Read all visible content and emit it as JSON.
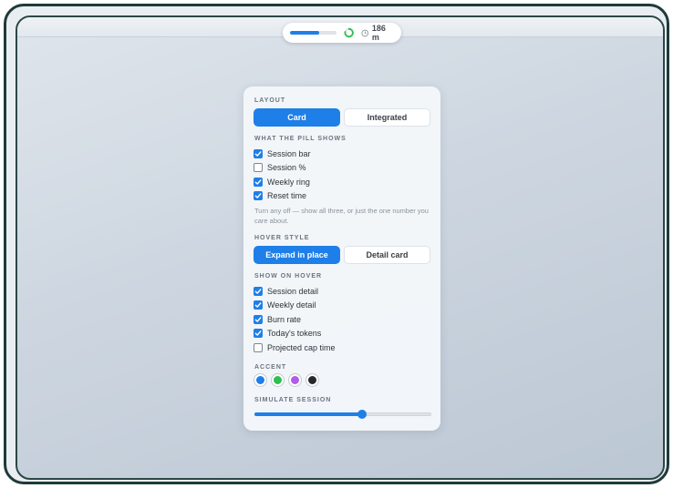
{
  "pill": {
    "session_fraction": 0.62,
    "ring_fraction": 0.78,
    "ring_color": "#2fbf4f",
    "time_text": "186 m",
    "clock_icon": "clock-icon"
  },
  "layout": {
    "label": "LAYOUT",
    "options": [
      "Card",
      "Integrated"
    ],
    "selected": 0
  },
  "pill_shows": {
    "label": "WHAT THE PILL SHOWS",
    "items": [
      {
        "label": "Session bar",
        "checked": true
      },
      {
        "label": "Session %",
        "checked": false
      },
      {
        "label": "Weekly ring",
        "checked": true
      },
      {
        "label": "Reset time",
        "checked": true
      }
    ],
    "hint": "Turn any off — show all three, or just the one number you care about."
  },
  "hover_style": {
    "label": "HOVER STYLE",
    "options": [
      "Expand in place",
      "Detail card"
    ],
    "selected": 0
  },
  "show_on_hover": {
    "label": "SHOW ON HOVER",
    "items": [
      {
        "label": "Session detail",
        "checked": true
      },
      {
        "label": "Weekly detail",
        "checked": true
      },
      {
        "label": "Burn rate",
        "checked": true
      },
      {
        "label": "Today's tokens",
        "checked": true
      },
      {
        "label": "Projected cap time",
        "checked": false
      }
    ]
  },
  "accent": {
    "label": "ACCENT",
    "colors": [
      "#1e7fe8",
      "#2fbf4f",
      "#b25be8",
      "#26282c"
    ],
    "selected": 0
  },
  "simulate": {
    "label": "SIMULATE SESSION",
    "value": 0.61
  }
}
